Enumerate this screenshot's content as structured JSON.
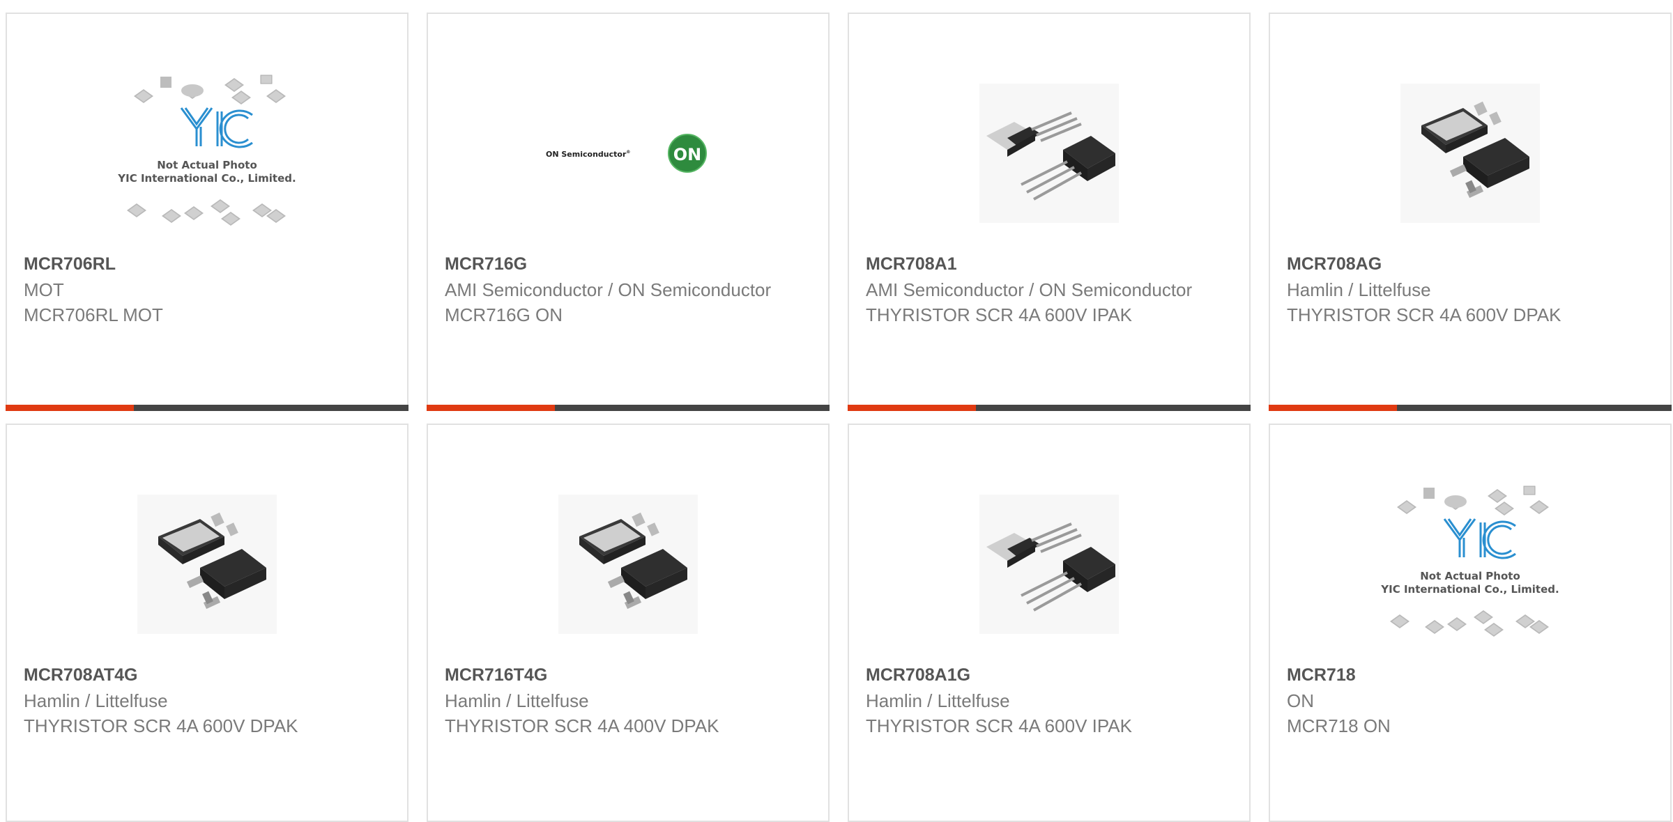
{
  "colors": {
    "accent": "#e03a12",
    "bar": "#444444",
    "border": "#e1e1e1",
    "text_bold": "#555555",
    "text": "#7a7a7a"
  },
  "placeholder": {
    "logo": "YIC",
    "line1": "Not Actual Photo",
    "line2": "YIC International Co., Limited."
  },
  "on_logo": {
    "brand": "ON Semiconductor",
    "badge": "ON"
  },
  "products": [
    {
      "part": "MCR706RL",
      "manufacturer": "MOT",
      "description": "MCR706RL MOT",
      "image": "placeholder"
    },
    {
      "part": "MCR716G",
      "manufacturer": "AMI Semiconductor / ON Semiconductor",
      "description": "MCR716G ON",
      "image": "on-logo"
    },
    {
      "part": "MCR708A1",
      "manufacturer": "AMI Semiconductor / ON Semiconductor",
      "description": "THYRISTOR SCR 4A 600V IPAK",
      "image": "ipak"
    },
    {
      "part": "MCR708AG",
      "manufacturer": "Hamlin / Littelfuse",
      "description": "THYRISTOR SCR 4A 600V DPAK",
      "image": "dpak"
    },
    {
      "part": "MCR708AT4G",
      "manufacturer": "Hamlin / Littelfuse",
      "description": "THYRISTOR SCR 4A 600V DPAK",
      "image": "dpak"
    },
    {
      "part": "MCR716T4G",
      "manufacturer": "Hamlin / Littelfuse",
      "description": "THYRISTOR SCR 4A 400V DPAK",
      "image": "dpak"
    },
    {
      "part": "MCR708A1G",
      "manufacturer": "Hamlin / Littelfuse",
      "description": "THYRISTOR SCR 4A 600V IPAK",
      "image": "ipak"
    },
    {
      "part": "MCR718",
      "manufacturer": "ON",
      "description": "MCR718 ON",
      "image": "placeholder"
    }
  ]
}
